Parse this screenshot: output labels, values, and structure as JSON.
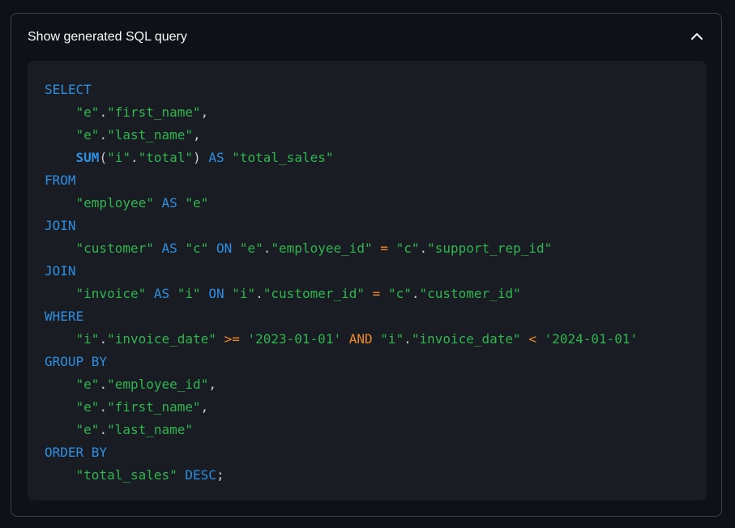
{
  "expander": {
    "title": "Show generated SQL query",
    "toggle_icon": "chevron-up-icon",
    "expanded": true
  },
  "colors": {
    "background": "#0e1117",
    "code_background": "#1a1c24",
    "border": "#3b3f4a",
    "keyword": "#2e8fe0",
    "string": "#2fb54e",
    "operator": "#f08a24",
    "punctuation": "#c9ccd3"
  },
  "code": {
    "language": "sql",
    "lines": [
      [
        {
          "t": "kw",
          "v": "SELECT"
        }
      ],
      [
        {
          "t": "ws",
          "v": "    "
        },
        {
          "t": "str",
          "v": "\"e\""
        },
        {
          "t": "punc",
          "v": "."
        },
        {
          "t": "str",
          "v": "\"first_name\""
        },
        {
          "t": "punc",
          "v": ","
        }
      ],
      [
        {
          "t": "ws",
          "v": "    "
        },
        {
          "t": "str",
          "v": "\"e\""
        },
        {
          "t": "punc",
          "v": "."
        },
        {
          "t": "str",
          "v": "\"last_name\""
        },
        {
          "t": "punc",
          "v": ","
        }
      ],
      [
        {
          "t": "ws",
          "v": "    "
        },
        {
          "t": "fn",
          "v": "SUM"
        },
        {
          "t": "punc",
          "v": "("
        },
        {
          "t": "str",
          "v": "\"i\""
        },
        {
          "t": "punc",
          "v": "."
        },
        {
          "t": "str",
          "v": "\"total\""
        },
        {
          "t": "punc",
          "v": ")"
        },
        {
          "t": "ws",
          "v": " "
        },
        {
          "t": "kw",
          "v": "AS"
        },
        {
          "t": "ws",
          "v": " "
        },
        {
          "t": "str",
          "v": "\"total_sales\""
        }
      ],
      [
        {
          "t": "kw",
          "v": "FROM"
        }
      ],
      [
        {
          "t": "ws",
          "v": "    "
        },
        {
          "t": "str",
          "v": "\"employee\""
        },
        {
          "t": "ws",
          "v": " "
        },
        {
          "t": "kw",
          "v": "AS"
        },
        {
          "t": "ws",
          "v": " "
        },
        {
          "t": "str",
          "v": "\"e\""
        }
      ],
      [
        {
          "t": "kw",
          "v": "JOIN"
        }
      ],
      [
        {
          "t": "ws",
          "v": "    "
        },
        {
          "t": "str",
          "v": "\"customer\""
        },
        {
          "t": "ws",
          "v": " "
        },
        {
          "t": "kw",
          "v": "AS"
        },
        {
          "t": "ws",
          "v": " "
        },
        {
          "t": "str",
          "v": "\"c\""
        },
        {
          "t": "ws",
          "v": " "
        },
        {
          "t": "kw",
          "v": "ON"
        },
        {
          "t": "ws",
          "v": " "
        },
        {
          "t": "str",
          "v": "\"e\""
        },
        {
          "t": "punc",
          "v": "."
        },
        {
          "t": "str",
          "v": "\"employee_id\""
        },
        {
          "t": "ws",
          "v": " "
        },
        {
          "t": "op",
          "v": "="
        },
        {
          "t": "ws",
          "v": " "
        },
        {
          "t": "str",
          "v": "\"c\""
        },
        {
          "t": "punc",
          "v": "."
        },
        {
          "t": "str",
          "v": "\"support_rep_id\""
        }
      ],
      [
        {
          "t": "kw",
          "v": "JOIN"
        }
      ],
      [
        {
          "t": "ws",
          "v": "    "
        },
        {
          "t": "str",
          "v": "\"invoice\""
        },
        {
          "t": "ws",
          "v": " "
        },
        {
          "t": "kw",
          "v": "AS"
        },
        {
          "t": "ws",
          "v": " "
        },
        {
          "t": "str",
          "v": "\"i\""
        },
        {
          "t": "ws",
          "v": " "
        },
        {
          "t": "kw",
          "v": "ON"
        },
        {
          "t": "ws",
          "v": " "
        },
        {
          "t": "str",
          "v": "\"i\""
        },
        {
          "t": "punc",
          "v": "."
        },
        {
          "t": "str",
          "v": "\"customer_id\""
        },
        {
          "t": "ws",
          "v": " "
        },
        {
          "t": "op",
          "v": "="
        },
        {
          "t": "ws",
          "v": " "
        },
        {
          "t": "str",
          "v": "\"c\""
        },
        {
          "t": "punc",
          "v": "."
        },
        {
          "t": "str",
          "v": "\"customer_id\""
        }
      ],
      [
        {
          "t": "kw",
          "v": "WHERE"
        }
      ],
      [
        {
          "t": "ws",
          "v": "    "
        },
        {
          "t": "str",
          "v": "\"i\""
        },
        {
          "t": "punc",
          "v": "."
        },
        {
          "t": "str",
          "v": "\"invoice_date\""
        },
        {
          "t": "ws",
          "v": " "
        },
        {
          "t": "op",
          "v": ">="
        },
        {
          "t": "ws",
          "v": " "
        },
        {
          "t": "str",
          "v": "'2023-01-01'"
        },
        {
          "t": "ws",
          "v": " "
        },
        {
          "t": "op",
          "v": "AND"
        },
        {
          "t": "ws",
          "v": " "
        },
        {
          "t": "str",
          "v": "\"i\""
        },
        {
          "t": "punc",
          "v": "."
        },
        {
          "t": "str",
          "v": "\"invoice_date\""
        },
        {
          "t": "ws",
          "v": " "
        },
        {
          "t": "op",
          "v": "<"
        },
        {
          "t": "ws",
          "v": " "
        },
        {
          "t": "str",
          "v": "'2024-01-01'"
        }
      ],
      [
        {
          "t": "kw",
          "v": "GROUP BY"
        }
      ],
      [
        {
          "t": "ws",
          "v": "    "
        },
        {
          "t": "str",
          "v": "\"e\""
        },
        {
          "t": "punc",
          "v": "."
        },
        {
          "t": "str",
          "v": "\"employee_id\""
        },
        {
          "t": "punc",
          "v": ","
        }
      ],
      [
        {
          "t": "ws",
          "v": "    "
        },
        {
          "t": "str",
          "v": "\"e\""
        },
        {
          "t": "punc",
          "v": "."
        },
        {
          "t": "str",
          "v": "\"first_name\""
        },
        {
          "t": "punc",
          "v": ","
        }
      ],
      [
        {
          "t": "ws",
          "v": "    "
        },
        {
          "t": "str",
          "v": "\"e\""
        },
        {
          "t": "punc",
          "v": "."
        },
        {
          "t": "str",
          "v": "\"last_name\""
        }
      ],
      [
        {
          "t": "kw",
          "v": "ORDER BY"
        }
      ],
      [
        {
          "t": "ws",
          "v": "    "
        },
        {
          "t": "str",
          "v": "\"total_sales\""
        },
        {
          "t": "ws",
          "v": " "
        },
        {
          "t": "kw",
          "v": "DESC"
        },
        {
          "t": "punc",
          "v": ";"
        }
      ]
    ]
  }
}
